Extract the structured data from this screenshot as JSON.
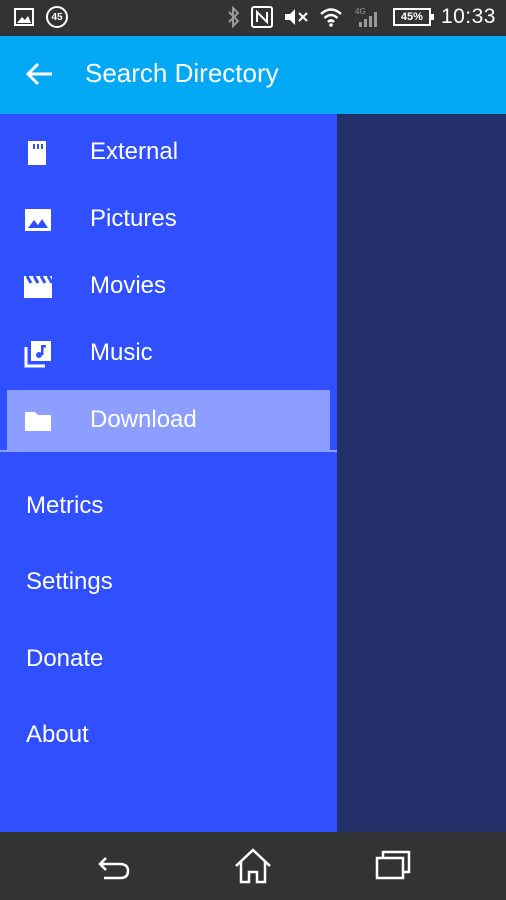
{
  "status_bar": {
    "notification_badge": "45",
    "battery_percent": "45%",
    "network_label": "4G",
    "time": "10:33"
  },
  "app_bar": {
    "title": "Search Directory",
    "back_icon": "arrow-back-icon"
  },
  "directories": [
    {
      "label": "External",
      "icon": "sd-card-icon",
      "selected": false
    },
    {
      "label": "Pictures",
      "icon": "image-icon",
      "selected": false
    },
    {
      "label": "Movies",
      "icon": "movie-icon",
      "selected": false
    },
    {
      "label": "Music",
      "icon": "music-library-icon",
      "selected": false
    },
    {
      "label": "Download",
      "icon": "folder-icon",
      "selected": true
    }
  ],
  "menu": [
    {
      "label": "Metrics"
    },
    {
      "label": "Settings"
    },
    {
      "label": "Donate"
    },
    {
      "label": "About"
    }
  ],
  "colors": {
    "app_bar": "#03a9f4",
    "drawer": "#304ffe",
    "selected_item": "#8c9eff",
    "scrim": "#23306a",
    "system_bars": "#323334"
  },
  "nav_bar": {
    "back_icon": "nav-back-icon",
    "home_icon": "nav-home-icon",
    "recents_icon": "nav-recents-icon"
  }
}
